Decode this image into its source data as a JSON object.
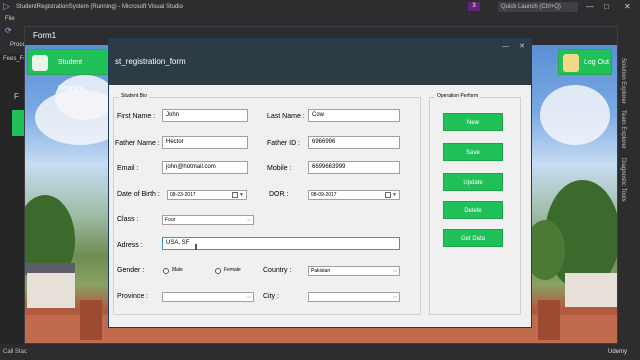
{
  "vs": {
    "title": "StudentRegistrationSystem (Running) - Microsoft Visual Studio",
    "menu_file": "File",
    "menu_process": "Proce",
    "tab_fees": "Fees_Fo",
    "quick_launch": "Quick Launch (Ctrl+Q)",
    "notif_count": "3",
    "left_f": "F",
    "bottom_call_stack": "Call Stac",
    "right_tabs": [
      "Solution Explorer",
      "Team Explorer",
      "Diagnostic Tools"
    ],
    "watermark": "Udemy",
    "ctrl_min": "—",
    "ctrl_max": "□",
    "ctrl_close": "✕"
  },
  "form1": {
    "title": "Form1",
    "header_student": "Student Registra",
    "header_logout": "Log Out"
  },
  "dialog": {
    "title": "st_registration_form",
    "ctrl_min": "—",
    "ctrl_close": "✕",
    "group_student": "Student Bio",
    "group_operation": "Operation Perform",
    "first_name_label": "First Name :",
    "first_name_value": "John",
    "last_name_label": "Last Name :",
    "last_name_value": "Cow",
    "father_name_label": "Father Name :",
    "father_name_value": "Hector",
    "father_id_label": "Father ID :",
    "father_id_value": "6966996",
    "email_label": "Email :",
    "email_value": "john@hotmail.com",
    "mobile_label": "Mobile :",
    "mobile_value": "6699663999",
    "dob_label": "Date of Birth :",
    "dob_value": "08-23-2017",
    "dor_label": "DOR :",
    "dor_value": "08-09-2017",
    "class_label": "Class :",
    "class_value": "Four",
    "address_label": "Adress :",
    "address_value": "USA, SF",
    "gender_label": "Gender :",
    "male_label": "Male",
    "female_label": "Female",
    "country_label": "Country :",
    "country_value": "Pakistan",
    "province_label": "Province :",
    "province_value": "",
    "city_label": "City :",
    "city_value": "",
    "buttons": [
      "New",
      "Save",
      "Update",
      "Delete",
      "Get Data"
    ]
  }
}
